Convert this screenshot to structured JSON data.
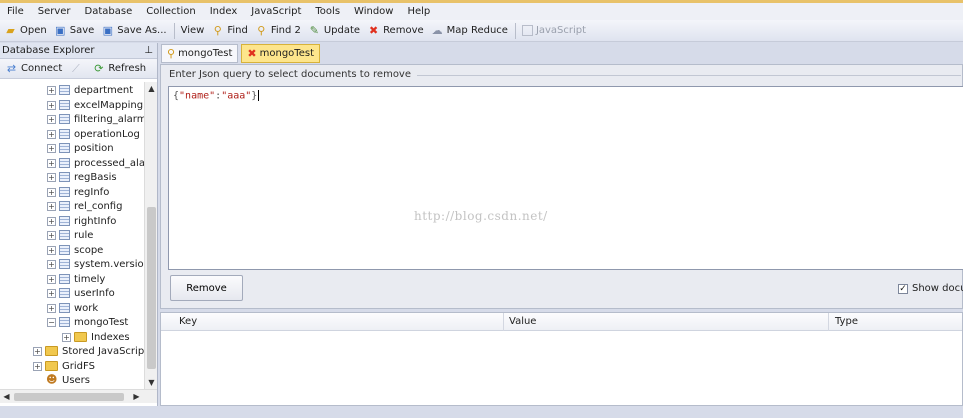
{
  "menu": [
    "File",
    "Server",
    "Database",
    "Collection",
    "Index",
    "JavaScript",
    "Tools",
    "Window",
    "Help"
  ],
  "toolbar": [
    {
      "label": "Open",
      "icon": "folder-open-icon",
      "glyph": "📂",
      "disabled": false
    },
    {
      "label": "Save",
      "icon": "save-icon",
      "glyph": "💾",
      "disabled": false
    },
    {
      "label": "Save As...",
      "icon": "save-as-icon",
      "glyph": "💾",
      "disabled": false
    },
    {
      "sep": true
    },
    {
      "label": "View",
      "icon": "",
      "glyph": "",
      "disabled": false
    },
    {
      "label": "Find",
      "icon": "find-icon",
      "glyph": "🔍",
      "disabled": false
    },
    {
      "label": "Find 2",
      "icon": "find2-icon",
      "glyph": "🔍",
      "disabled": false
    },
    {
      "label": "Update",
      "icon": "update-icon",
      "glyph": "📝",
      "disabled": false
    },
    {
      "label": "Remove",
      "icon": "remove-icon",
      "glyph": "✖",
      "disabled": false
    },
    {
      "label": "Map Reduce",
      "icon": "map-reduce-icon",
      "glyph": "☁",
      "disabled": false
    },
    {
      "sep": true
    },
    {
      "label": "JavaScript",
      "icon": "javascript-icon",
      "glyph": "▭",
      "disabled": true
    }
  ],
  "explorer": {
    "title": "Database Explorer",
    "pin": "ᵖ",
    "connect": "Connect",
    "refresh": "Refresh",
    "collections": [
      "department",
      "excelMapping",
      "filtering_alarm",
      "operationLog",
      "position",
      "processed_alarr",
      "regBasis",
      "regInfo",
      "rel_config",
      "rightInfo",
      "rule",
      "scope",
      "system.version",
      "timely",
      "userInfo",
      "work",
      "mongoTest"
    ],
    "indexes": "Indexes",
    "stored_js": "Stored JavaScript",
    "gridfs": "GridFS",
    "users": "Users"
  },
  "tabs": [
    {
      "label": "mongoTest",
      "icon": "find-icon",
      "glyph": "🔍",
      "active": false
    },
    {
      "label": "mongoTest",
      "icon": "remove-icon",
      "glyph": "✖",
      "active": true
    }
  ],
  "remove_panel": {
    "legend": "Enter Json query to select documents to remove",
    "query": {
      "open": "{",
      "key": "\"name\"",
      "colon": ":",
      "value": "\"aaa\"",
      "close": "}"
    },
    "watermark": "http://blog.csdn.net/",
    "remove_button": "Remove",
    "show_docs": "Show docum",
    "show_docs_checked": true
  },
  "results": {
    "columns": [
      "Key",
      "Value",
      "Type"
    ]
  },
  "colors": {
    "active_tab": "#fde58c",
    "remove_icon": "#e0301e",
    "string": "#b0201a"
  }
}
